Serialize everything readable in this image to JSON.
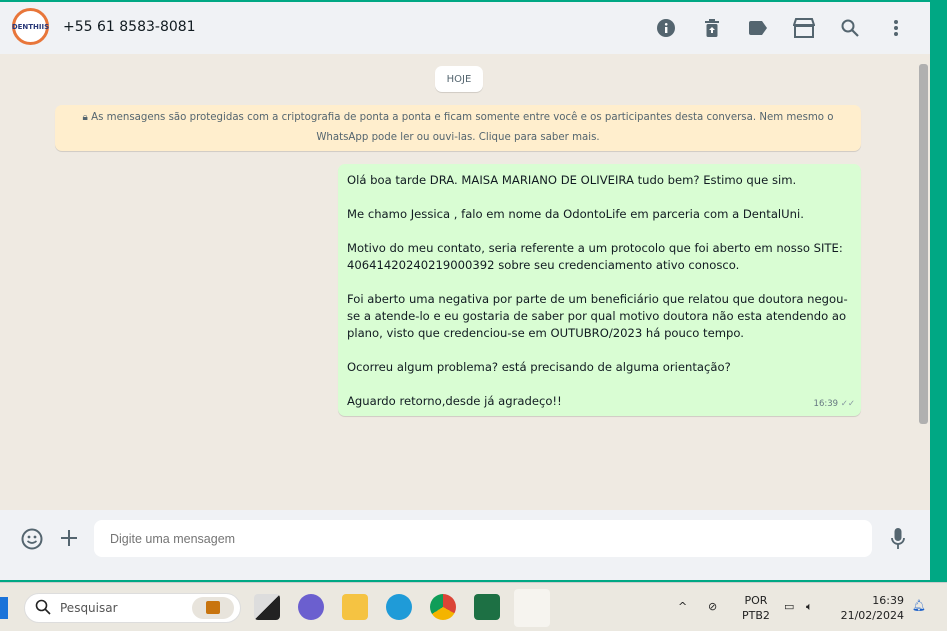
{
  "header": {
    "avatar_text": "DENTHIIS",
    "phone": "+55 61 8583-8081",
    "icons": [
      "info-icon",
      "delete-icon",
      "label-icon",
      "store-icon",
      "search-icon",
      "more-vertical-icon"
    ]
  },
  "chat": {
    "date_divider": "HOJE",
    "encryption_notice": "As mensagens são protegidas com a criptografia de ponta a ponta e ficam somente entre você e os participantes desta conversa. Nem mesmo o WhatsApp pode ler ou ouvi-las. Clique para saber mais.",
    "message": {
      "paragraphs": [
        "Olá boa tarde DRA. MAISA MARIANO DE OLIVEIRA tudo bem? Estimo que sim.",
        "Me chamo Jessica , falo em nome da OdontoLife em parceria com a DentalUni.",
        "Motivo do meu contato, seria referente a um protocolo que foi aberto em nosso SITE: 40641420240219000392 sobre seu credenciamento ativo conosco.",
        "Foi aberto uma negativa por parte de um beneficiário que relatou que doutora negou-se a atende-lo e eu gostaria de saber por qual motivo doutora não esta atendendo ao plano, visto que credenciou-se em OUTUBRO/2023 há pouco tempo.",
        "Ocorreu algum problema? está precisando de alguma orientação?",
        "Aguardo retorno,desde já agradeço!!"
      ],
      "time": "16:39",
      "status": "✓✓"
    }
  },
  "composer": {
    "placeholder": "Digite uma mensagem"
  },
  "taskbar": {
    "search_placeholder": "Pesquisar",
    "lang_top": "POR",
    "lang_bottom": "PTB2",
    "time": "16:39",
    "date": "21/02/2024"
  }
}
